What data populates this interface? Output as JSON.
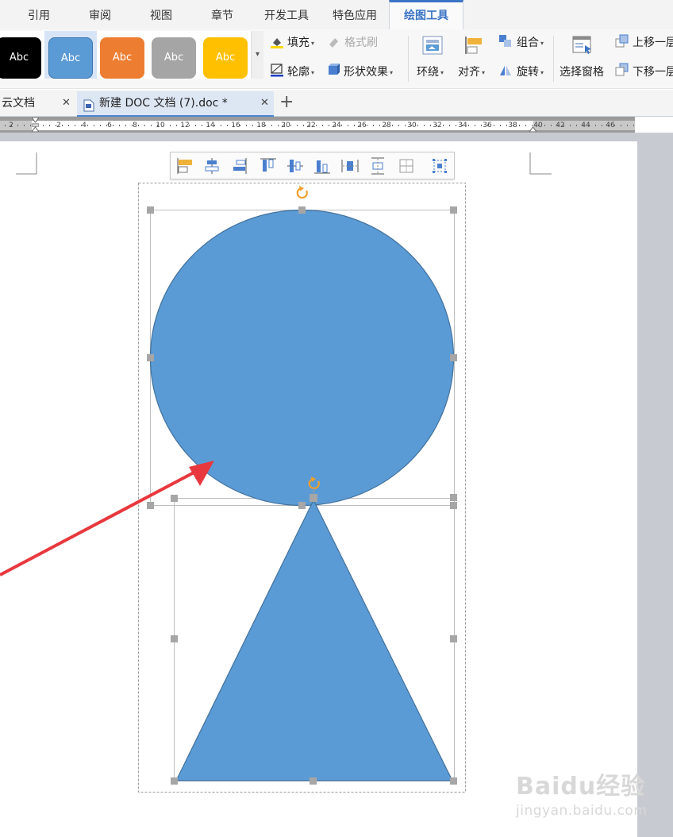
{
  "menu_tabs": [
    {
      "label": "引用",
      "active": false
    },
    {
      "label": "审阅",
      "active": false
    },
    {
      "label": "视图",
      "active": false
    },
    {
      "label": "章节",
      "active": false
    },
    {
      "label": "开发工具",
      "active": false
    },
    {
      "label": "特色应用",
      "active": false
    },
    {
      "label": "绘图工具",
      "active": true
    }
  ],
  "ribbon": {
    "style_swatches": [
      {
        "label": "Abc",
        "color": "#000000",
        "text_color": "#ffffff"
      },
      {
        "label": "Abc",
        "color": "#5b9bd5",
        "text_color": "#ffffff",
        "selected": true
      },
      {
        "label": "Abc",
        "color": "#ed7d31",
        "text_color": "#ffffff"
      },
      {
        "label": "Abc",
        "color": "#a5a5a5",
        "text_color": "#ffffff"
      },
      {
        "label": "Abc",
        "color": "#ffc000",
        "text_color": "#ffffff"
      }
    ],
    "fill_label": "填充",
    "format_painter_label": "格式刷",
    "outline_label": "轮廓",
    "shape_effect_label": "形状效果",
    "wrap_label": "环绕",
    "align_label": "对齐",
    "group_label": "组合",
    "rotate_label": "旋转",
    "selection_pane_label": "选择窗格",
    "bring_forward_label": "上移一层",
    "send_backward_label": "下移一层"
  },
  "doc_tabs": [
    {
      "label": "云文档",
      "active": false
    },
    {
      "label": "新建 DOC 文档 (7).doc *",
      "active": true
    }
  ],
  "ruler": {
    "labels": [
      "2",
      "2",
      "4",
      "6",
      "8",
      "10",
      "12",
      "14",
      "16",
      "18",
      "20",
      "22",
      "24",
      "26",
      "28",
      "30",
      "32",
      "34",
      "36",
      "38",
      "40",
      "42",
      "44",
      "46"
    ]
  },
  "float_toolbar": {
    "buttons": [
      "align-left",
      "align-center",
      "align-right",
      "align-top",
      "align-middle",
      "align-bottom",
      "distribute-horizontal",
      "distribute-vertical",
      "equal-spacing",
      "select-frame"
    ]
  },
  "shapes": {
    "fill": "#5b9bd5",
    "stroke": "#41719c",
    "handle_color": "#a6a6a6",
    "rotate_color": "#f0a02c"
  },
  "annotation": {
    "arrow_color": "#e8383d"
  },
  "watermark": {
    "brand": "Baidu经验",
    "url": "jingyan.baidu.com"
  }
}
